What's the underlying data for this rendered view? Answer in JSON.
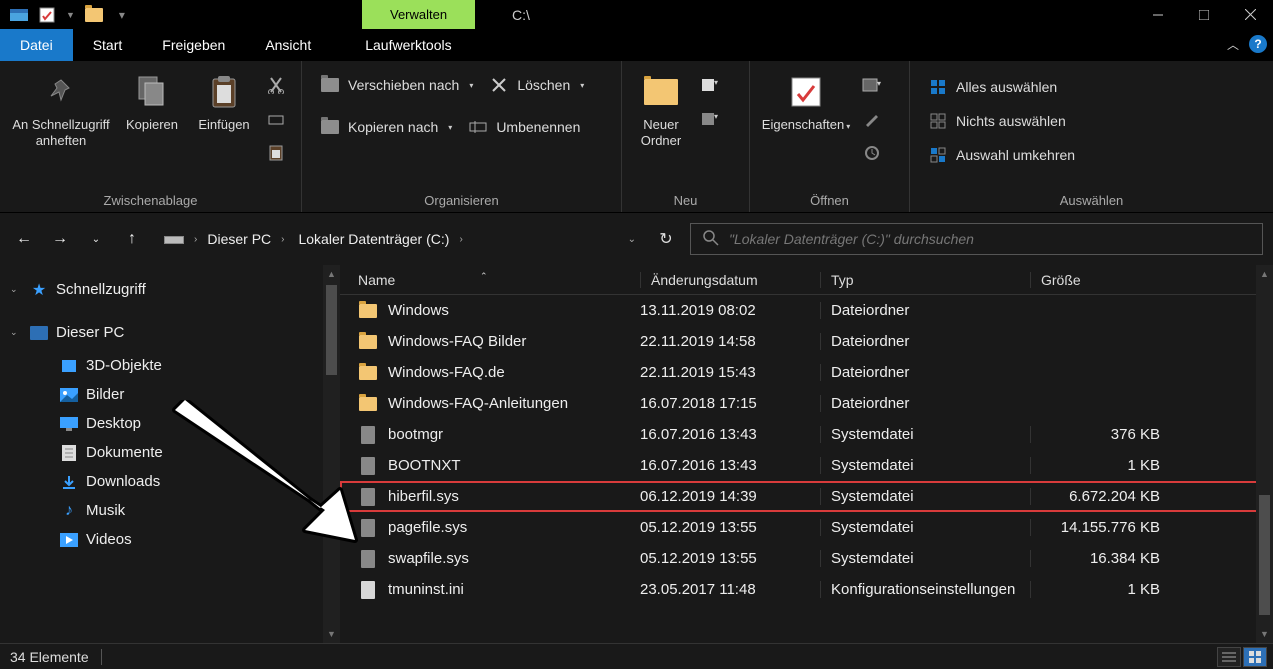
{
  "title_bar": {
    "manage": "Verwalten",
    "title": "C:\\"
  },
  "tabs": {
    "file": "Datei",
    "home": "Start",
    "share": "Freigeben",
    "view": "Ansicht",
    "drive_tools": "Laufwerktools"
  },
  "ribbon": {
    "clipboard": {
      "label": "Zwischenablage",
      "pin": "An Schnellzugriff anheften",
      "copy": "Kopieren",
      "paste": "Einfügen"
    },
    "organize": {
      "label": "Organisieren",
      "move_to": "Verschieben nach",
      "copy_to": "Kopieren nach",
      "delete": "Löschen",
      "rename": "Umbenennen"
    },
    "new": {
      "label": "Neu",
      "new_folder": "Neuer Ordner"
    },
    "open": {
      "label": "Öffnen",
      "properties": "Eigenschaften"
    },
    "select": {
      "label": "Auswählen",
      "select_all": "Alles auswählen",
      "select_none": "Nichts auswählen",
      "invert": "Auswahl umkehren"
    }
  },
  "breadcrumb": {
    "root": "Dieser PC",
    "drive": "Lokaler Datenträger (C:)"
  },
  "search": {
    "placeholder": "\"Lokaler Datenträger (C:)\" durchsuchen"
  },
  "sidebar": {
    "items": [
      {
        "label": "Schnellzugriff",
        "icon": "star",
        "level": 1,
        "expandable": true
      },
      {
        "label": "Dieser PC",
        "icon": "pc",
        "level": 1,
        "expandable": true
      },
      {
        "label": "3D-Objekte",
        "icon": "3d",
        "level": 2
      },
      {
        "label": "Bilder",
        "icon": "pictures",
        "level": 2
      },
      {
        "label": "Desktop",
        "icon": "desktop",
        "level": 2
      },
      {
        "label": "Dokumente",
        "icon": "documents",
        "level": 2
      },
      {
        "label": "Downloads",
        "icon": "downloads",
        "level": 2
      },
      {
        "label": "Musik",
        "icon": "music",
        "level": 2
      },
      {
        "label": "Videos",
        "icon": "videos",
        "level": 2
      }
    ]
  },
  "columns": {
    "name": "Name",
    "date": "Änderungsdatum",
    "type": "Typ",
    "size": "Größe"
  },
  "rows": [
    {
      "name": "Windows",
      "date": "13.11.2019 08:02",
      "type": "Dateiordner",
      "size": "",
      "icon": "folder"
    },
    {
      "name": "Windows-FAQ Bilder",
      "date": "22.11.2019 14:58",
      "type": "Dateiordner",
      "size": "",
      "icon": "folder"
    },
    {
      "name": "Windows-FAQ.de",
      "date": "22.11.2019 15:43",
      "type": "Dateiordner",
      "size": "",
      "icon": "folder"
    },
    {
      "name": "Windows-FAQ-Anleitungen",
      "date": "16.07.2018 17:15",
      "type": "Dateiordner",
      "size": "",
      "icon": "folder"
    },
    {
      "name": "bootmgr",
      "date": "16.07.2016 13:43",
      "type": "Systemdatei",
      "size": "376 KB",
      "icon": "sys"
    },
    {
      "name": "BOOTNXT",
      "date": "16.07.2016 13:43",
      "type": "Systemdatei",
      "size": "1 KB",
      "icon": "sys"
    },
    {
      "name": "hiberfil.sys",
      "date": "06.12.2019 14:39",
      "type": "Systemdatei",
      "size": "6.672.204 KB",
      "icon": "sys",
      "highlight": true
    },
    {
      "name": "pagefile.sys",
      "date": "05.12.2019 13:55",
      "type": "Systemdatei",
      "size": "14.155.776 KB",
      "icon": "sys"
    },
    {
      "name": "swapfile.sys",
      "date": "05.12.2019 13:55",
      "type": "Systemdatei",
      "size": "16.384 KB",
      "icon": "sys"
    },
    {
      "name": "tmuninst.ini",
      "date": "23.05.2017 11:48",
      "type": "Konfigurationseinstellungen",
      "size": "1 KB",
      "icon": "ini"
    }
  ],
  "status": {
    "count": "34 Elemente"
  }
}
